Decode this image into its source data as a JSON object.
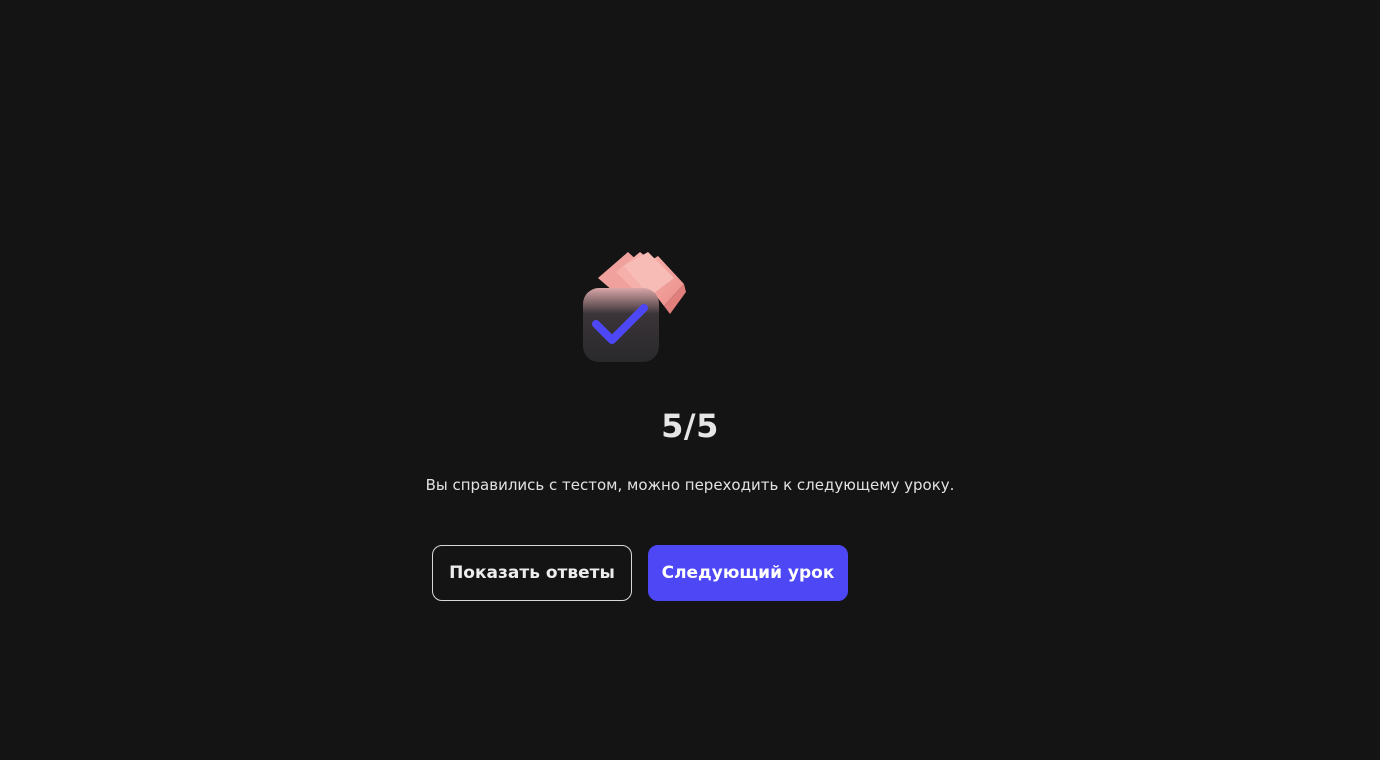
{
  "result": {
    "score": "5/5",
    "message": "Вы справились с тестом, можно переходить к следующему уроку."
  },
  "actions": {
    "show_answers_label": "Показать ответы",
    "next_lesson_label": "Следующий урок"
  },
  "colors": {
    "background": "#141414",
    "accent": "#4d47f6",
    "cards": "#f4a7a3",
    "checkbox": "#2a2a2e"
  },
  "icons": {
    "illustration": "checkbox-with-cards-icon"
  }
}
